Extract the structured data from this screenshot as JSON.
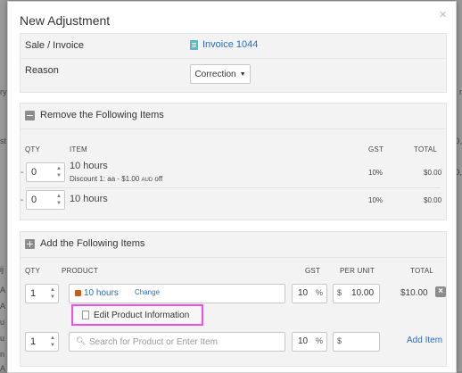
{
  "background": {
    "left_text": [
      "ry",
      "st",
      "ij",
      "A",
      "A",
      "u",
      "u",
      "n",
      "A"
    ],
    "right_text": [
      "r",
      "D,",
      "D,"
    ]
  },
  "modal": {
    "title": "New Adjustment",
    "close_icon": "×"
  },
  "info": {
    "sale_label": "Sale / Invoice",
    "invoice_link": "Invoice 1044",
    "reason_label": "Reason",
    "reason_value": "Correction",
    "reason_caret": "▼"
  },
  "remove_section": {
    "title": "Remove the Following Items",
    "headers": {
      "qty": "QTY",
      "item": "ITEM",
      "gst": "GST",
      "total": "TOTAL"
    },
    "rows": [
      {
        "dash": "-",
        "qty": "0",
        "name": "10 hours",
        "discount": "Discount 1: aa - $1.00",
        "discount_unit": "AUD",
        "discount_suffix": "off",
        "gst": "10%",
        "total": "$0.00"
      },
      {
        "dash": "-",
        "qty": "0",
        "name": "10 hours",
        "gst": "10%",
        "total": "$0.00"
      }
    ]
  },
  "add_section": {
    "title": "Add the Following Items",
    "headers": {
      "qty": "QTY",
      "product": "PRODUCT",
      "gst": "GST",
      "per_unit": "PER UNIT",
      "total": "TOTAL"
    },
    "row": {
      "qty": "1",
      "product": "10 hours",
      "change": "Change",
      "gst": "10",
      "percent": "%",
      "currency": "$",
      "price": "10.00",
      "total": "$10.00",
      "remove": "×"
    },
    "edit_info": "Edit Product Information",
    "new_row": {
      "qty": "1",
      "search_placeholder": "Search for Product or Enter Item",
      "gst": "10",
      "percent": "%",
      "currency": "$",
      "add_item": "Add Item"
    }
  },
  "spinner": {
    "up": "▲",
    "down": "▼"
  },
  "icons": {
    "search": "search-icon",
    "document": "document-icon",
    "product": "product-box-icon",
    "page": "page-icon"
  },
  "colors": {
    "link": "#2a6ebb",
    "highlight": "#ee4fe6",
    "panel": "#f3f3f3"
  }
}
